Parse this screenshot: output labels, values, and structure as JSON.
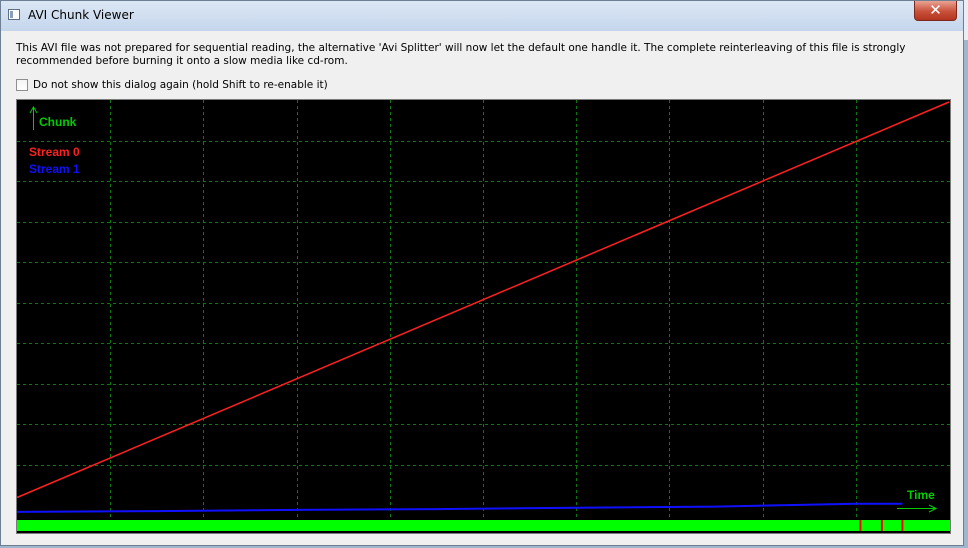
{
  "window": {
    "title": "AVI Chunk Viewer",
    "close_glyph": "✕"
  },
  "message": "This AVI file was not prepared for sequential reading, the alternative 'Avi Splitter' will now let the default one handle it. The complete reinterleaving of this file is strongly recommended before burning it onto a slow media like cd-rom.",
  "checkbox": {
    "label": "Do not show this dialog again (hold Shift to re-enable it)",
    "checked": false
  },
  "chart_data": {
    "type": "line",
    "ylabel": "Chunk",
    "xlabel": "Time",
    "grid": true,
    "legend_position": "top-left",
    "x_range": [
      0,
      1
    ],
    "y_range": [
      0,
      1
    ],
    "series": [
      {
        "name": "Stream 0",
        "color": "#ff2020",
        "x": [
          0,
          1
        ],
        "y": [
          0.04,
          1
        ]
      },
      {
        "name": "Stream 1",
        "color": "#1010ff",
        "x": [
          0,
          0.15,
          0.3,
          0.45,
          0.6,
          0.75,
          0.9,
          0.95
        ],
        "y": [
          0.005,
          0.007,
          0.01,
          0.012,
          0.015,
          0.018,
          0.025,
          0.025
        ]
      }
    ],
    "bar_color": "#00ff00",
    "bar_markers_color": "#ff0000",
    "bar_markers_x": [
      0.905,
      0.928,
      0.95
    ]
  }
}
